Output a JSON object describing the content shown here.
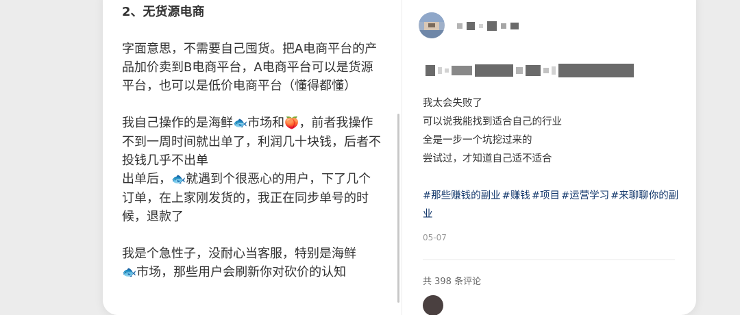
{
  "post": {
    "heading": "2、无货源电商",
    "para1": "字面意思，不需要自己囤货。把A电商平台的产品加价卖到B电商平台，A电商平台可以是货源平台，也可以是低价电商平台（懂得都懂）",
    "para2_a": "我自己操作的是海鲜",
    "para2_b": "市场和",
    "para2_c": "，前者我操作不到一周时间就出单了，利润几十块钱，后者不投钱几乎不出单",
    "para2_d": "出单后，",
    "para2_e": "就遇到个很恶心的用户，下了几个订单，在上家刚发货的，我正在同步单号的时候，退款了",
    "para3_a": "我是个急性子，没耐心当客服，特别是海鲜",
    "para3_b": "市场，那些用户会刷新你对砍价的认知",
    "emoji_fish": "🐟",
    "emoji_peach": "🍑"
  },
  "sidebar": {
    "desc_lines": [
      "我太会失败了",
      "可以说我能找到适合自己的行业",
      "全是一步一个坑挖过来的",
      "尝试过，才知道自己适不适合"
    ],
    "tags": [
      "#那些赚钱的副业",
      "#赚钱",
      "#项目",
      "#运营学习",
      "#来聊聊你的副业"
    ],
    "date": "05-07",
    "comment_count": "共 398 条评论"
  },
  "colors": {
    "background": "#ececec",
    "card": "#ffffff",
    "text": "#333333",
    "tag": "#13386c",
    "muted": "#999999"
  }
}
